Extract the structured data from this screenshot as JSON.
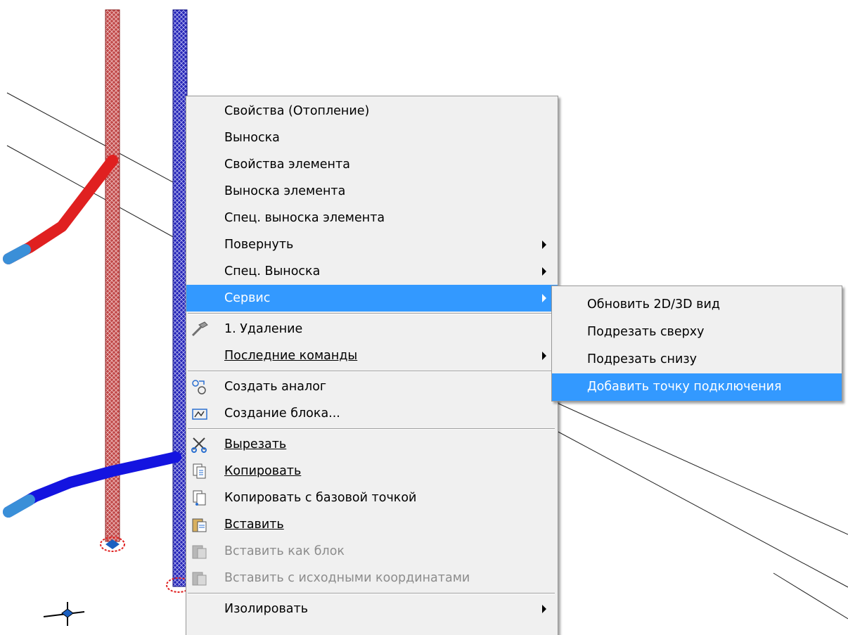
{
  "colors": {
    "highlight": "#3399ff",
    "supply_pipe": "#e02020",
    "return_pipe": "#1414e0",
    "connection_pipe": "#3a8fd8",
    "menu_bg": "#f0f0f0"
  },
  "context_menu": {
    "items": [
      {
        "label": "Свойства (Отопление)",
        "submenu": false
      },
      {
        "label": "Выноска",
        "submenu": false
      },
      {
        "label": "Свойства элемента",
        "submenu": false
      },
      {
        "label": "Выноска элемента",
        "submenu": false
      },
      {
        "label": "Спец. выноска элемента",
        "submenu": false
      },
      {
        "label": "Повернуть",
        "submenu": true
      },
      {
        "label": "Спец. Выноска",
        "submenu": true
      },
      {
        "label": "Сервис",
        "submenu": true,
        "highlighted": true
      },
      {
        "label": "1. Удаление",
        "icon": "hammer-icon"
      },
      {
        "label": "Последние команды",
        "submenu": true
      },
      {
        "label": "Создать аналог",
        "icon": "create-analog-icon"
      },
      {
        "label": "Создание блока...",
        "icon": "create-block-icon"
      },
      {
        "label": "Вырезать",
        "icon": "scissors-icon"
      },
      {
        "label": "Копировать",
        "icon": "copy-icon"
      },
      {
        "label": "Копировать с базовой точкой",
        "icon": "copy-base-point-icon"
      },
      {
        "label": "Вставить",
        "icon": "paste-icon"
      },
      {
        "label": "Вставить как блок",
        "icon": "paste-as-block-icon",
        "disabled": true
      },
      {
        "label": "Вставить с исходными координатами",
        "icon": "paste-original-coords-icon",
        "disabled": true
      },
      {
        "label": "Изолировать",
        "submenu": true
      }
    ]
  },
  "service_submenu": {
    "items": [
      {
        "label": "Обновить 2D/3D вид"
      },
      {
        "label": "Подрезать сверху"
      },
      {
        "label": "Подрезать снизу"
      },
      {
        "label": "Добавить точку подключения",
        "highlighted": true
      }
    ]
  }
}
